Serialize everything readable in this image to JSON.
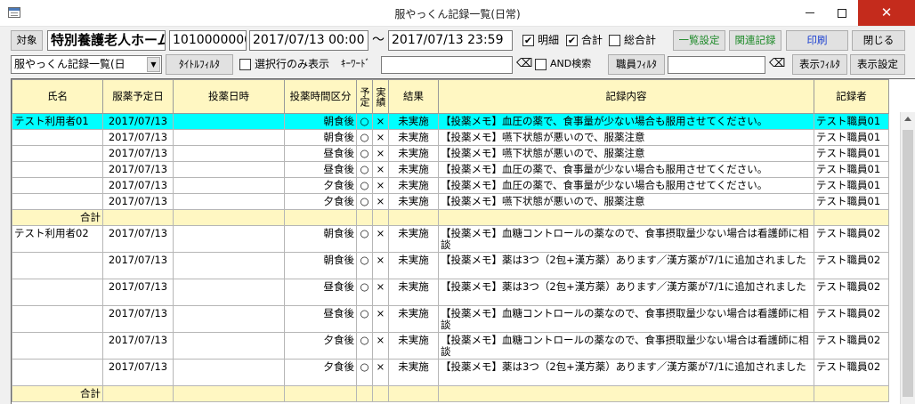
{
  "window": {
    "title": "服やっくん記録一覧(日常)",
    "minimize": "—",
    "maximize": "□",
    "close": "✕"
  },
  "toolbar": {
    "target_label": "対象",
    "facility_name": "特別養護老人ホーム",
    "facility_code": "1010000000",
    "date_from": "2017/07/13 00:00",
    "tilde": "～",
    "date_to": "2017/07/13 23:59",
    "detail_label": "明細",
    "detail_checked": true,
    "total_label": "合計",
    "total_checked": true,
    "grand_total_label": "総合計",
    "grand_total_checked": false,
    "list_settings_button": "一覧設定",
    "related_records_button": "関連記録",
    "print_button": "印刷",
    "close_button": "閉じる"
  },
  "filterbar": {
    "list_select_value": "服やっくん記録一覧(日",
    "title_filter_button": "ﾀｲﾄﾙﾌｨﾙﾀ",
    "selected_only_label": "選択行のみ表示",
    "keyword_label": "ｷｰﾜｰﾄﾞ",
    "keyword_value": "",
    "and_search_label": "AND検索",
    "staff_filter_button": "職員ﾌｨﾙﾀ",
    "staff_filter_value": "",
    "display_filter_button": "表示ﾌｨﾙﾀ",
    "display_settings_button": "表示設定"
  },
  "table": {
    "columns": [
      "氏名",
      "服薬予定日",
      "投薬日時",
      "投薬時間区分",
      "予定",
      "実績",
      "結果",
      "記録内容",
      "記録者"
    ],
    "rows": [
      {
        "type": "data",
        "selected": true,
        "tall": false,
        "name": "テスト利用者01",
        "date": "2017/07/13",
        "dose_time": "",
        "period": "朝食後",
        "plan": "○",
        "actual": "×",
        "result": "未実施",
        "content": "【投薬メモ】血圧の薬で、食事量が少ない場合も服用させてください。",
        "recorder": "テスト職員01"
      },
      {
        "type": "data",
        "selected": false,
        "tall": false,
        "name": "",
        "date": "2017/07/13",
        "dose_time": "",
        "period": "朝食後",
        "plan": "○",
        "actual": "×",
        "result": "未実施",
        "content": "【投薬メモ】嚥下状態が悪いので、服薬注意",
        "recorder": "テスト職員01"
      },
      {
        "type": "data",
        "selected": false,
        "tall": false,
        "name": "",
        "date": "2017/07/13",
        "dose_time": "",
        "period": "昼食後",
        "plan": "○",
        "actual": "×",
        "result": "未実施",
        "content": "【投薬メモ】嚥下状態が悪いので、服薬注意",
        "recorder": "テスト職員01"
      },
      {
        "type": "data",
        "selected": false,
        "tall": false,
        "name": "",
        "date": "2017/07/13",
        "dose_time": "",
        "period": "昼食後",
        "plan": "○",
        "actual": "×",
        "result": "未実施",
        "content": "【投薬メモ】血圧の薬で、食事量が少ない場合も服用させてください。",
        "recorder": "テスト職員01"
      },
      {
        "type": "data",
        "selected": false,
        "tall": false,
        "name": "",
        "date": "2017/07/13",
        "dose_time": "",
        "period": "夕食後",
        "plan": "○",
        "actual": "×",
        "result": "未実施",
        "content": "【投薬メモ】血圧の薬で、食事量が少ない場合も服用させてください。",
        "recorder": "テスト職員01"
      },
      {
        "type": "data",
        "selected": false,
        "tall": false,
        "name": "",
        "date": "2017/07/13",
        "dose_time": "",
        "period": "夕食後",
        "plan": "○",
        "actual": "×",
        "result": "未実施",
        "content": "【投薬メモ】嚥下状態が悪いので、服薬注意",
        "recorder": "テスト職員01"
      },
      {
        "type": "subtotal",
        "label": "合計"
      },
      {
        "type": "data",
        "selected": false,
        "tall": true,
        "name": "テスト利用者02",
        "date": "2017/07/13",
        "dose_time": "",
        "period": "朝食後",
        "plan": "○",
        "actual": "×",
        "result": "未実施",
        "content": "【投薬メモ】血糖コントロールの薬なので、食事摂取量少ない場合は看護師に相談",
        "recorder": "テスト職員02"
      },
      {
        "type": "data",
        "selected": false,
        "tall": true,
        "name": "",
        "date": "2017/07/13",
        "dose_time": "",
        "period": "朝食後",
        "plan": "○",
        "actual": "×",
        "result": "未実施",
        "content": "【投薬メモ】薬は3つ（2包+漢方薬）あります／漢方薬が7/1に追加されました",
        "recorder": "テスト職員02"
      },
      {
        "type": "data",
        "selected": false,
        "tall": true,
        "name": "",
        "date": "2017/07/13",
        "dose_time": "",
        "period": "昼食後",
        "plan": "○",
        "actual": "×",
        "result": "未実施",
        "content": "【投薬メモ】薬は3つ（2包+漢方薬）あります／漢方薬が7/1に追加されました",
        "recorder": "テスト職員02"
      },
      {
        "type": "data",
        "selected": false,
        "tall": true,
        "name": "",
        "date": "2017/07/13",
        "dose_time": "",
        "period": "昼食後",
        "plan": "○",
        "actual": "×",
        "result": "未実施",
        "content": "【投薬メモ】血糖コントロールの薬なので、食事摂取量少ない場合は看護師に相談",
        "recorder": "テスト職員02"
      },
      {
        "type": "data",
        "selected": false,
        "tall": true,
        "name": "",
        "date": "2017/07/13",
        "dose_time": "",
        "period": "夕食後",
        "plan": "○",
        "actual": "×",
        "result": "未実施",
        "content": "【投薬メモ】血糖コントロールの薬なので、食事摂取量少ない場合は看護師に相談",
        "recorder": "テスト職員02"
      },
      {
        "type": "data",
        "selected": false,
        "tall": true,
        "name": "",
        "date": "2017/07/13",
        "dose_time": "",
        "period": "夕食後",
        "plan": "○",
        "actual": "×",
        "result": "未実施",
        "content": "【投薬メモ】薬は3つ（2包+漢方薬）あります／漢方薬が7/1に追加されました",
        "recorder": "テスト職員02"
      },
      {
        "type": "subtotal",
        "label": "合計"
      }
    ]
  }
}
